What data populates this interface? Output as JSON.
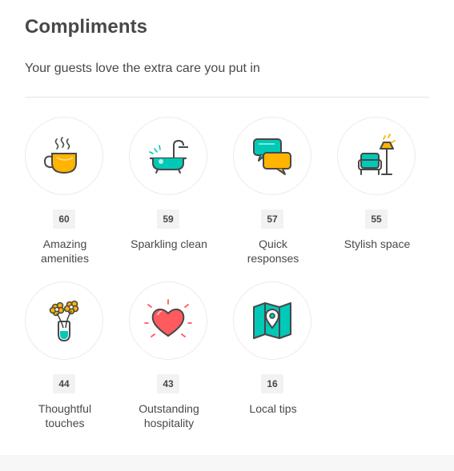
{
  "header": {
    "title": "Compliments",
    "subtitle": "Your guests love the extra care you put in"
  },
  "colors": {
    "text": "#484848",
    "teal": "#00c9b8",
    "yellow": "#ffb400",
    "red": "#ff5a5f",
    "count_bg": "#f2f2f2"
  },
  "compliments": [
    {
      "icon": "tea-cup-icon",
      "count": "60",
      "label": "Amazing\namenities"
    },
    {
      "icon": "bathtub-icon",
      "count": "59",
      "label": "Sparkling clean"
    },
    {
      "icon": "chat-bubbles-icon",
      "count": "57",
      "label": "Quick\nresponses"
    },
    {
      "icon": "chair-lamp-icon",
      "count": "55",
      "label": "Stylish space"
    },
    {
      "icon": "flowers-vase-icon",
      "count": "44",
      "label": "Thoughtful\ntouches"
    },
    {
      "icon": "heart-icon",
      "count": "43",
      "label": "Outstanding\nhospitality"
    },
    {
      "icon": "map-pin-icon",
      "count": "16",
      "label": "Local tips"
    }
  ]
}
